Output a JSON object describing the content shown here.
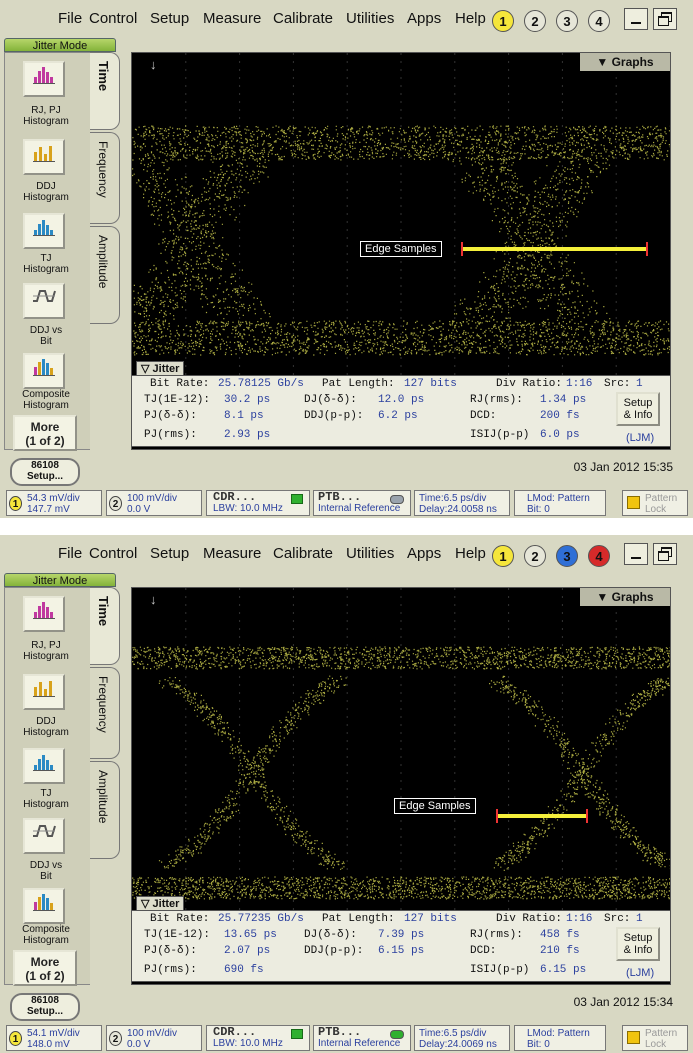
{
  "menu": [
    "File",
    "Control",
    "Setup",
    "Measure",
    "Calibrate",
    "Utilities",
    "Apps",
    "Help"
  ],
  "channels": [
    "1",
    "2",
    "3",
    "4"
  ],
  "mode_tab": "Jitter Mode",
  "tools": [
    {
      "label": "RJ, PJ\nHistogram",
      "icon": "rjpj-histogram-icon"
    },
    {
      "label": "DDJ\nHistogram",
      "icon": "ddj-histogram-icon"
    },
    {
      "label": "TJ\nHistogram",
      "icon": "tj-histogram-icon"
    },
    {
      "label": "DDJ vs\nBit",
      "icon": "ddj-vs-bit-icon"
    },
    {
      "label": "Composite\nHistogram",
      "icon": "composite-histogram-icon"
    }
  ],
  "more_button": "More\n(1 of 2)",
  "vtabs": [
    "Time",
    "Frequency",
    "Amplitude"
  ],
  "graphs_label": "Graphs",
  "edge_samples_label": "Edge Samples",
  "jitter_tab": "Jitter",
  "setup_info_label": "Setup\n& Info",
  "ljm_label": "(LJM)",
  "setup_86108": "86108\nSetup...",
  "labels": {
    "bit_rate": "Bit Rate:",
    "pat_length": "Pat Length:",
    "div_ratio": "Div Ratio:",
    "src": "Src:",
    "tj": "TJ(1E-12):",
    "dj": "DJ(δ-δ):",
    "rj": "RJ(rms):",
    "pj_dd": "PJ(δ-δ):",
    "ddj": "DDJ(p-p):",
    "dcd": "DCD:",
    "pj_rms": "PJ(rms):",
    "isij": "ISIJ(p-p)"
  },
  "colors": {
    "ch1": "#f5e63b",
    "ch2": "#e0e0cf",
    "ch3": "#2f6fd6",
    "ch4": "#d62a2a",
    "accent": "#2a3f9e",
    "eye": "#a8a840"
  },
  "screenshots": [
    {
      "channel_fills": [
        "#f5e63b",
        "#e6e6d8",
        "#e6e6d8",
        "#e6e6d8"
      ],
      "measurements": {
        "bit_rate": "25.78125 Gb/s",
        "pat_length": "127 bits",
        "div_ratio": "1:16",
        "src": "1",
        "tj": "30.2 ps",
        "dj": "12.0 ps",
        "rj": "1.34 ps",
        "pj_dd": "8.1 ps",
        "ddj": "6.2 ps",
        "dcd": "200 fs",
        "pj_rms": "2.93 ps",
        "isij": "6.0 ps"
      },
      "datetime": "03 Jan 2012  15:35",
      "status": {
        "ch1_scale": "54.3 mV/div",
        "ch1_offset": "147.7 mV",
        "ch2_scale": "100 mV/div",
        "ch2_offset": "0.0 V",
        "cdr_title": "CDR...",
        "cdr_sub": "LBW: 10.0 MHz",
        "ptb_title": "PTB...",
        "ptb_sub": "Internal Reference",
        "time_scale": "Time:6.5 ps/div",
        "delay": "Delay:24.0058 ns",
        "lmod": "LMod: Pattern",
        "bit": "Bit: 0",
        "pattern_lock": "Pattern\nLock"
      }
    },
    {
      "channel_fills": [
        "#f5e63b",
        "#e6e6d8",
        "#2f6fd6",
        "#d62a2a"
      ],
      "measurements": {
        "bit_rate": "25.77235 Gb/s",
        "pat_length": "127 bits",
        "div_ratio": "1:16",
        "src": "1",
        "tj": "13.65 ps",
        "dj": "7.39 ps",
        "rj": "458 fs",
        "pj_dd": "2.07 ps",
        "ddj": "6.15 ps",
        "dcd": "210 fs",
        "pj_rms": "690 fs",
        "isij": "6.15 ps"
      },
      "datetime": "03 Jan 2012  15:34",
      "status": {
        "ch1_scale": "54.1 mV/div",
        "ch1_offset": "148.0 mV",
        "ch2_scale": "100 mV/div",
        "ch2_offset": "0.0 V",
        "cdr_title": "CDR...",
        "cdr_sub": "LBW: 10.0 MHz",
        "ptb_title": "PTB...",
        "ptb_sub": "Internal Reference",
        "time_scale": "Time:6.5 ps/div",
        "delay": "Delay:24.0069 ns",
        "lmod": "LMod: Pattern",
        "bit": "Bit: 0",
        "pattern_lock": "Pattern\nLock"
      }
    }
  ]
}
